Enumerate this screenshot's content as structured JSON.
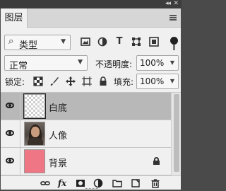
{
  "window": {
    "collapse_icon": "double-chevron-icon",
    "close_icon": "close-icon"
  },
  "panel": {
    "tab_label": "图层",
    "menu_icon": "hamburger-menu-icon"
  },
  "filter": {
    "kind_label": "类型",
    "icons": [
      "image-filter-icon",
      "adjustment-filter-icon",
      "type-filter-icon",
      "shape-filter-icon",
      "smart-object-filter-icon"
    ],
    "toggle_on": true
  },
  "blending": {
    "mode": "正常",
    "opacity_label": "不透明度:",
    "opacity_value": "100%"
  },
  "lock": {
    "label": "锁定:",
    "icons": [
      "lock-transparent-pixels-icon",
      "lock-image-pixels-icon",
      "lock-position-icon",
      "lock-artboard-icon",
      "lock-all-icon"
    ],
    "fill_label": "填充:",
    "fill_value": "100%"
  },
  "layers": [
    {
      "name": "白底",
      "visible": true,
      "selected": true,
      "thumb": "transparent",
      "locked": false
    },
    {
      "name": "人像",
      "visible": true,
      "selected": false,
      "thumb": "photo",
      "locked": false
    },
    {
      "name": "背景",
      "visible": true,
      "selected": false,
      "thumb": "pink",
      "thumb_color": "#ee7685",
      "locked": true
    }
  ],
  "footer": {
    "fx_label": "fx",
    "icons": [
      "link-layers-icon",
      "layer-style-icon",
      "add-mask-icon",
      "new-adjustment-layer-icon",
      "new-group-icon",
      "new-layer-icon",
      "delete-layer-icon"
    ]
  }
}
